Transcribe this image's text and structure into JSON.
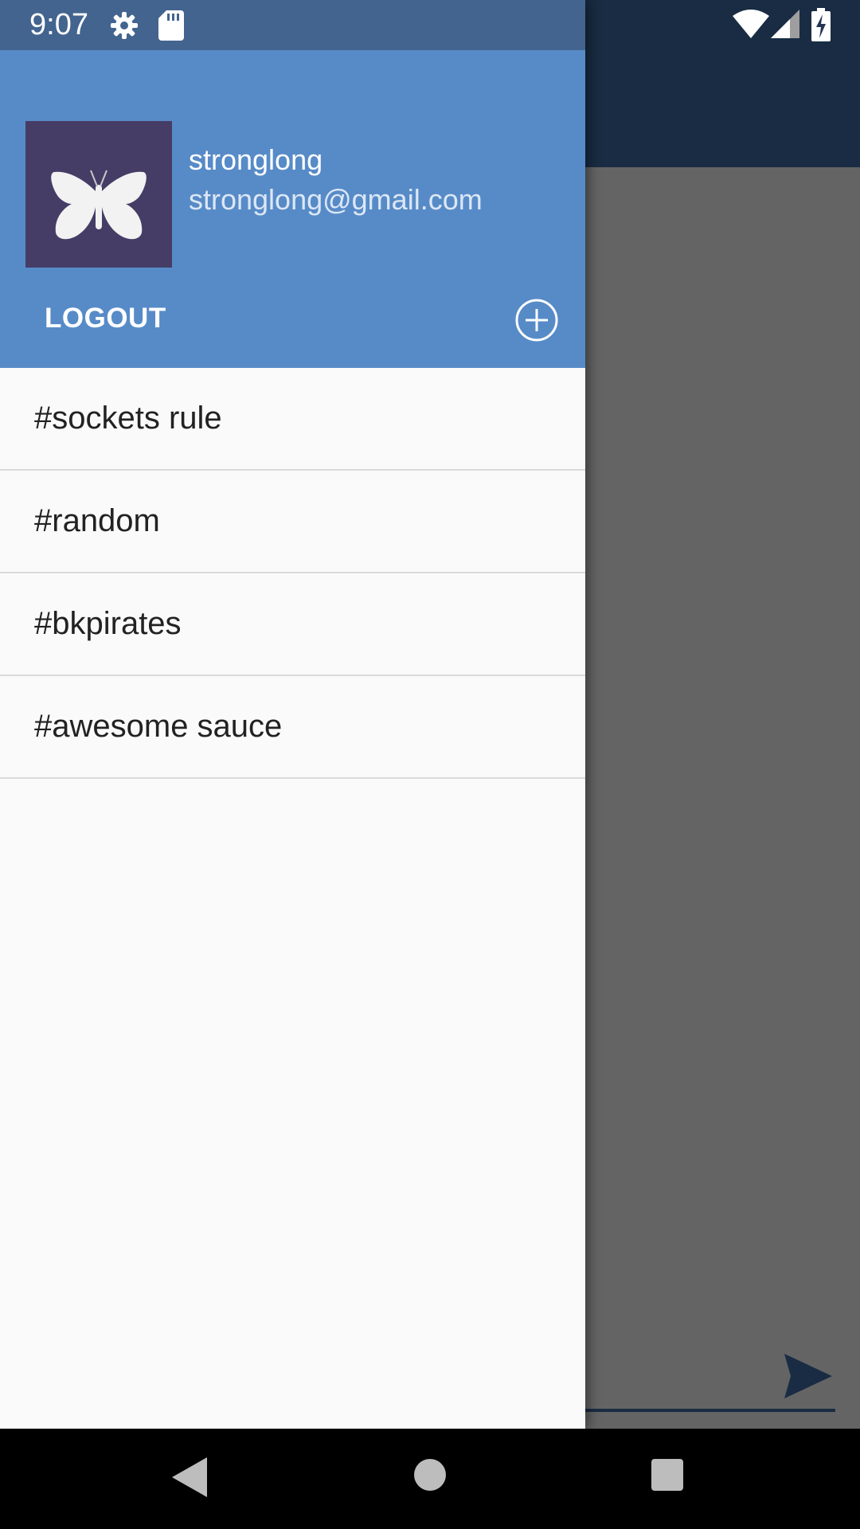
{
  "status_bar": {
    "time": "9:07",
    "icons": [
      "gear-icon",
      "sd-card-icon",
      "wifi-icon",
      "signal-icon",
      "battery-charging-icon"
    ]
  },
  "drawer": {
    "user": {
      "name": "stronglong",
      "email": "stronglong@gmail.com",
      "avatar_icon": "butterfly-icon"
    },
    "logout_label": "LOGOUT",
    "add_icon": "add-circle-icon",
    "channels": [
      {
        "label": "#sockets rule"
      },
      {
        "label": "#random"
      },
      {
        "label": "#bkpirates"
      },
      {
        "label": "#awesome sauce"
      }
    ]
  },
  "background_app": {
    "send_icon": "send-icon"
  },
  "nav_bar": {
    "icons": [
      "back-icon",
      "home-icon",
      "recents-icon"
    ]
  },
  "colors": {
    "drawer_header": "#578bc8",
    "status_bar": "#43648f",
    "toolbar": "#3f6ea8",
    "avatar_bg": "#453d66",
    "drawer_bg": "#fafafa"
  }
}
